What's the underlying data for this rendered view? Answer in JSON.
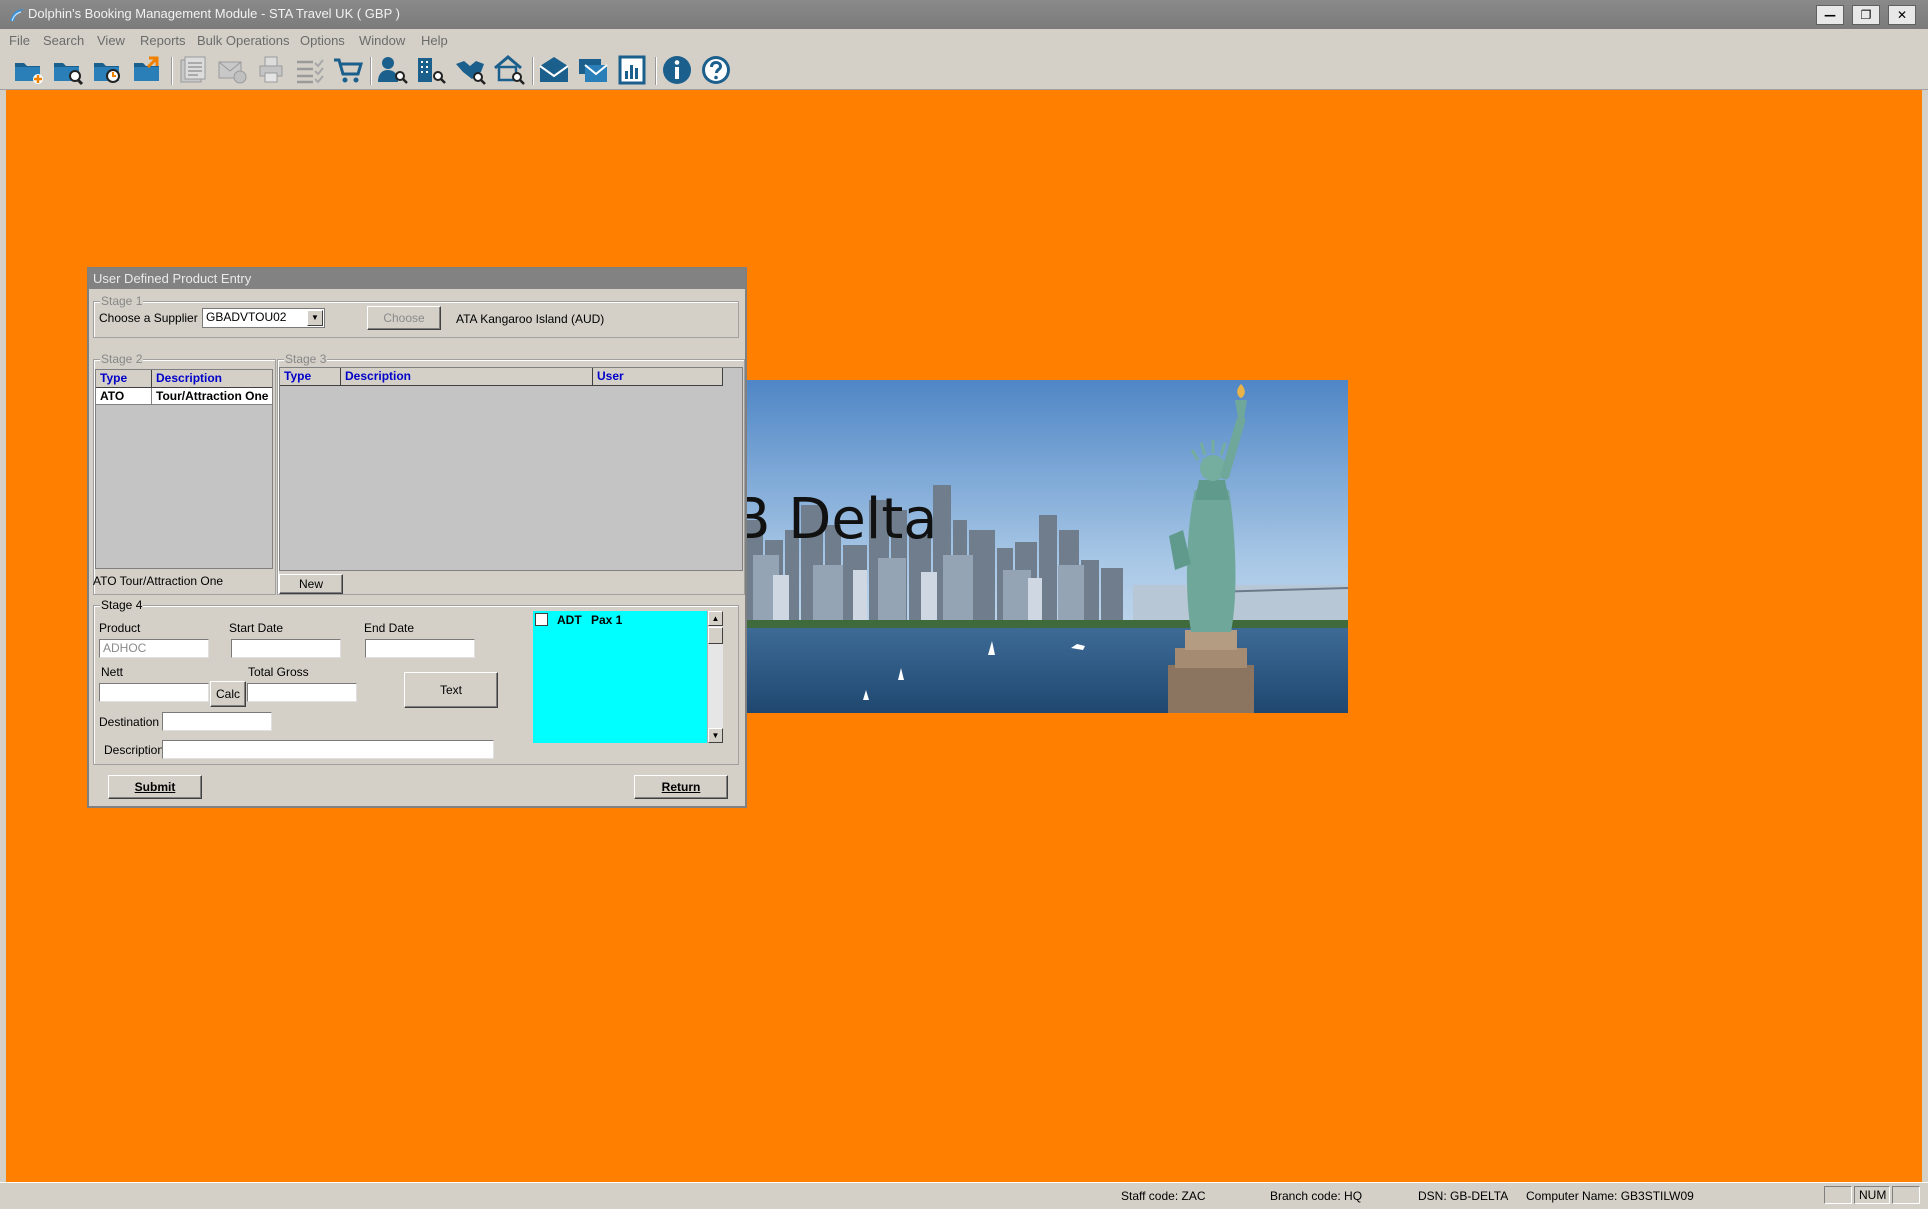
{
  "window": {
    "title": "Dolphin's Booking Management Module - STA Travel UK ( GBP )",
    "controls": {
      "minimize": "—",
      "restore": "❐",
      "close": "✕"
    }
  },
  "menu": [
    "File",
    "Search",
    "View",
    "Reports",
    "Bulk Operations",
    "Options",
    "Window",
    "Help"
  ],
  "toolbar": {
    "icons": [
      "new-booking-icon",
      "search-folder-icon",
      "recent-folder-icon",
      "export-folder-icon",
      "document-list-icon",
      "mail-merge-icon",
      "print-icon",
      "checklist-icon",
      "shopping-cart-icon",
      "customer-search-icon",
      "building-search-icon",
      "handshake-search-icon",
      "house-search-icon",
      "envelope-icon",
      "email-queue-icon",
      "report-icon",
      "info-icon",
      "help-icon"
    ]
  },
  "background": {
    "color": "#ff8000",
    "banner_text": "B Delta"
  },
  "dialog": {
    "title": "User Defined Product Entry",
    "stage1": {
      "label": "Stage 1",
      "supplier_label": "Choose a Supplier",
      "supplier_value": "GBADVTOU02",
      "choose_button": "Choose",
      "supplier_name": "ATA Kangaroo Island (AUD)"
    },
    "stage2": {
      "label": "Stage 2",
      "columns": [
        "Type",
        "Description"
      ],
      "rows": [
        [
          "ATO",
          "Tour/Attraction One"
        ]
      ],
      "selected_text": "ATO Tour/Attraction One"
    },
    "stage3": {
      "label": "Stage 3",
      "columns": [
        "Type",
        "Description",
        "User"
      ],
      "rows": [],
      "new_button": "New"
    },
    "stage4": {
      "label": "Stage 4",
      "product_label": "Product",
      "product_value": "ADHOC",
      "start_date_label": "Start Date",
      "start_date_value": "",
      "end_date_label": "End Date",
      "end_date_value": "",
      "nett_label": "Nett",
      "nett_value": "",
      "calc_button": "Calc",
      "total_gross_label": "Total Gross",
      "total_gross_value": "",
      "text_button": "Text",
      "destination_label": "Destination",
      "destination_value": "",
      "description_label": "Description",
      "description_value": "",
      "pax": [
        {
          "type": "ADT",
          "name": "Pax 1",
          "checked": false
        }
      ],
      "pax_bg": "#00ffff"
    },
    "submit_button": "Submit",
    "return_button": "Return"
  },
  "statusbar": {
    "staff": "Staff code: ZAC",
    "branch": "Branch code: HQ",
    "dsn": "DSN: GB-DELTA",
    "computer": "Computer Name: GB3STILW09",
    "num": "NUM"
  }
}
